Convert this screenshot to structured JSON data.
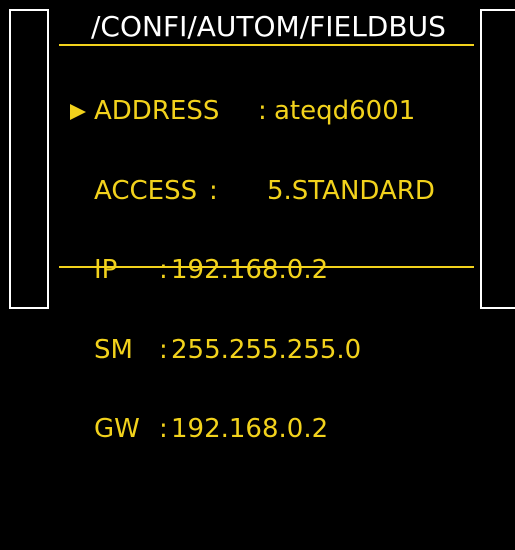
{
  "header": {
    "path": "/CONFI/AUTOM/FIELDBUS"
  },
  "menu": {
    "rows": [
      {
        "label": "ADDRESS",
        "separator": ":",
        "value": "ateqd6001",
        "selected": true
      },
      {
        "label": "ACCESS",
        "separator": ":",
        "value": "5.STANDARD",
        "selected": false
      },
      {
        "label": "IP",
        "separator": ":",
        "value": "192.168.0.2",
        "selected": false
      },
      {
        "label": "SM",
        "separator": ":",
        "value": "255.255.255.0",
        "selected": false
      },
      {
        "label": "GW",
        "separator": ":",
        "value": "192.168.0.2",
        "selected": false
      }
    ]
  },
  "colors": {
    "background": "#000000",
    "title": "#ffffff",
    "text": "#f2d21c",
    "frame": "#ffffff"
  }
}
